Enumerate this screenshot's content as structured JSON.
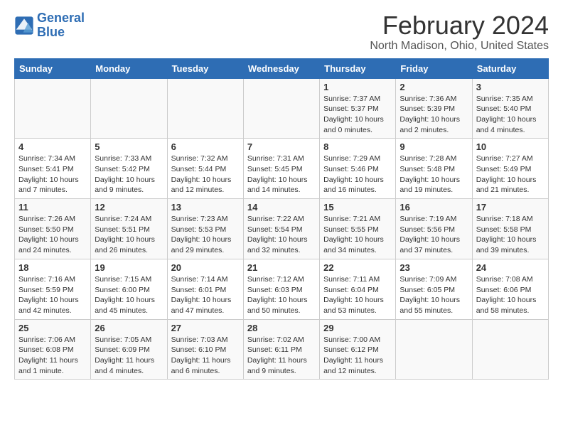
{
  "logo": {
    "line1": "General",
    "line2": "Blue"
  },
  "title": "February 2024",
  "subtitle": "North Madison, Ohio, United States",
  "days_of_week": [
    "Sunday",
    "Monday",
    "Tuesday",
    "Wednesday",
    "Thursday",
    "Friday",
    "Saturday"
  ],
  "weeks": [
    [
      {
        "day": "",
        "info": ""
      },
      {
        "day": "",
        "info": ""
      },
      {
        "day": "",
        "info": ""
      },
      {
        "day": "",
        "info": ""
      },
      {
        "day": "1",
        "info": "Sunrise: 7:37 AM\nSunset: 5:37 PM\nDaylight: 10 hours and 0 minutes."
      },
      {
        "day": "2",
        "info": "Sunrise: 7:36 AM\nSunset: 5:39 PM\nDaylight: 10 hours and 2 minutes."
      },
      {
        "day": "3",
        "info": "Sunrise: 7:35 AM\nSunset: 5:40 PM\nDaylight: 10 hours and 4 minutes."
      }
    ],
    [
      {
        "day": "4",
        "info": "Sunrise: 7:34 AM\nSunset: 5:41 PM\nDaylight: 10 hours and 7 minutes."
      },
      {
        "day": "5",
        "info": "Sunrise: 7:33 AM\nSunset: 5:42 PM\nDaylight: 10 hours and 9 minutes."
      },
      {
        "day": "6",
        "info": "Sunrise: 7:32 AM\nSunset: 5:44 PM\nDaylight: 10 hours and 12 minutes."
      },
      {
        "day": "7",
        "info": "Sunrise: 7:31 AM\nSunset: 5:45 PM\nDaylight: 10 hours and 14 minutes."
      },
      {
        "day": "8",
        "info": "Sunrise: 7:29 AM\nSunset: 5:46 PM\nDaylight: 10 hours and 16 minutes."
      },
      {
        "day": "9",
        "info": "Sunrise: 7:28 AM\nSunset: 5:48 PM\nDaylight: 10 hours and 19 minutes."
      },
      {
        "day": "10",
        "info": "Sunrise: 7:27 AM\nSunset: 5:49 PM\nDaylight: 10 hours and 21 minutes."
      }
    ],
    [
      {
        "day": "11",
        "info": "Sunrise: 7:26 AM\nSunset: 5:50 PM\nDaylight: 10 hours and 24 minutes."
      },
      {
        "day": "12",
        "info": "Sunrise: 7:24 AM\nSunset: 5:51 PM\nDaylight: 10 hours and 26 minutes."
      },
      {
        "day": "13",
        "info": "Sunrise: 7:23 AM\nSunset: 5:53 PM\nDaylight: 10 hours and 29 minutes."
      },
      {
        "day": "14",
        "info": "Sunrise: 7:22 AM\nSunset: 5:54 PM\nDaylight: 10 hours and 32 minutes."
      },
      {
        "day": "15",
        "info": "Sunrise: 7:21 AM\nSunset: 5:55 PM\nDaylight: 10 hours and 34 minutes."
      },
      {
        "day": "16",
        "info": "Sunrise: 7:19 AM\nSunset: 5:56 PM\nDaylight: 10 hours and 37 minutes."
      },
      {
        "day": "17",
        "info": "Sunrise: 7:18 AM\nSunset: 5:58 PM\nDaylight: 10 hours and 39 minutes."
      }
    ],
    [
      {
        "day": "18",
        "info": "Sunrise: 7:16 AM\nSunset: 5:59 PM\nDaylight: 10 hours and 42 minutes."
      },
      {
        "day": "19",
        "info": "Sunrise: 7:15 AM\nSunset: 6:00 PM\nDaylight: 10 hours and 45 minutes."
      },
      {
        "day": "20",
        "info": "Sunrise: 7:14 AM\nSunset: 6:01 PM\nDaylight: 10 hours and 47 minutes."
      },
      {
        "day": "21",
        "info": "Sunrise: 7:12 AM\nSunset: 6:03 PM\nDaylight: 10 hours and 50 minutes."
      },
      {
        "day": "22",
        "info": "Sunrise: 7:11 AM\nSunset: 6:04 PM\nDaylight: 10 hours and 53 minutes."
      },
      {
        "day": "23",
        "info": "Sunrise: 7:09 AM\nSunset: 6:05 PM\nDaylight: 10 hours and 55 minutes."
      },
      {
        "day": "24",
        "info": "Sunrise: 7:08 AM\nSunset: 6:06 PM\nDaylight: 10 hours and 58 minutes."
      }
    ],
    [
      {
        "day": "25",
        "info": "Sunrise: 7:06 AM\nSunset: 6:08 PM\nDaylight: 11 hours and 1 minute."
      },
      {
        "day": "26",
        "info": "Sunrise: 7:05 AM\nSunset: 6:09 PM\nDaylight: 11 hours and 4 minutes."
      },
      {
        "day": "27",
        "info": "Sunrise: 7:03 AM\nSunset: 6:10 PM\nDaylight: 11 hours and 6 minutes."
      },
      {
        "day": "28",
        "info": "Sunrise: 7:02 AM\nSunset: 6:11 PM\nDaylight: 11 hours and 9 minutes."
      },
      {
        "day": "29",
        "info": "Sunrise: 7:00 AM\nSunset: 6:12 PM\nDaylight: 11 hours and 12 minutes."
      },
      {
        "day": "",
        "info": ""
      },
      {
        "day": "",
        "info": ""
      }
    ]
  ]
}
